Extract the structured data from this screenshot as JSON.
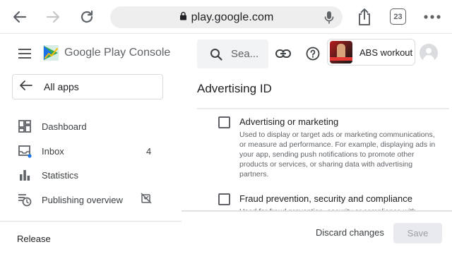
{
  "browser": {
    "url": "play.google.com",
    "tab_count": "23"
  },
  "console": {
    "logo_text": "Google Play Console",
    "all_apps_label": "All apps",
    "search_placeholder": "Sea..."
  },
  "sidebar": {
    "items": [
      {
        "label": "Dashboard",
        "icon": "dashboard-icon"
      },
      {
        "label": "Inbox",
        "icon": "inbox-icon",
        "count": "4"
      },
      {
        "label": "Statistics",
        "icon": "bar-chart-icon"
      },
      {
        "label": "Publishing overview",
        "icon": "publishing-icon"
      }
    ],
    "section_label": "Release"
  },
  "app": {
    "name": "ABS workout"
  },
  "page": {
    "title": "Advertising ID",
    "options": [
      {
        "title": "Advertising or marketing",
        "description": "Used to display or target ads or marketing communications, or measure ad performance. For example, displaying ads in your app, sending push notifications to promote other products or services, or sharing data with advertising partners.",
        "checked": false
      },
      {
        "title": "Fraud prevention, security and compliance",
        "description": "Used for fraud prevention, security or compliance with",
        "checked": false
      }
    ]
  },
  "footer": {
    "discard_label": "Discard changes",
    "save_label": "Save"
  },
  "colors": {
    "accent_blue": "#1a73e8",
    "text_primary": "#202124",
    "text_secondary": "#5f6368"
  }
}
